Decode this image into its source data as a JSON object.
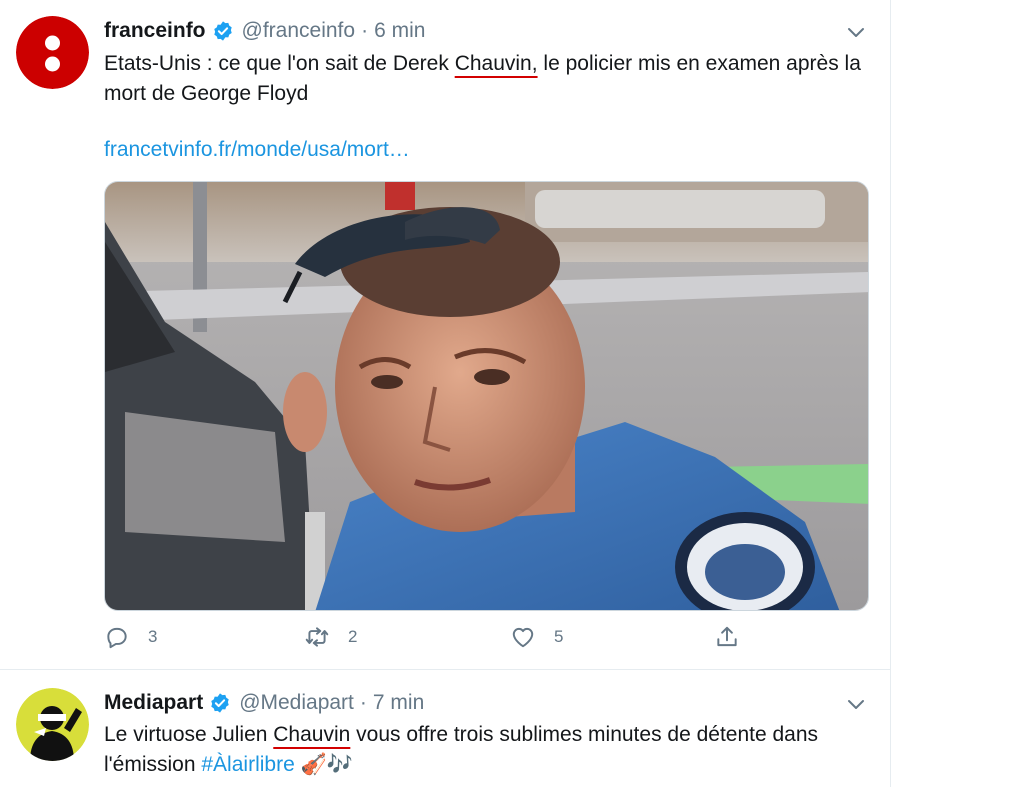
{
  "tweets": [
    {
      "display_name": "franceinfo",
      "handle": "@franceinfo",
      "separator": "·",
      "time": "6 min",
      "text_before": "Etats-Unis : ce que l'on sait de Derek ",
      "text_highlight": "Chauvin,",
      "text_after": " le policier mis en examen après la mort de George Floyd",
      "link": "francetvinfo.fr/monde/usa/mort…",
      "replies": "3",
      "retweets": "2",
      "likes": "5"
    },
    {
      "display_name": "Mediapart",
      "handle": "@Mediapart",
      "separator": "·",
      "time": "7 min",
      "text_before": "Le virtuose Julien ",
      "text_highlight": "Chauvin",
      "text_after": " vous offre trois sublimes minutes de détente dans l'émission ",
      "hashtag": "#Àlairlibre",
      "emoji": "🎻🎶"
    }
  ],
  "colors": {
    "brand_red": "#cc0000",
    "link_blue": "#1b95e0",
    "verified_blue": "#1da1f2",
    "muted": "#657786",
    "highlight_underline": "#d20000"
  },
  "icons": [
    "franceinfo-logo-icon",
    "verified-badge-icon",
    "chevron-down-icon",
    "reply-icon",
    "retweet-icon",
    "like-icon",
    "share-icon",
    "mediapart-logo-icon"
  ]
}
